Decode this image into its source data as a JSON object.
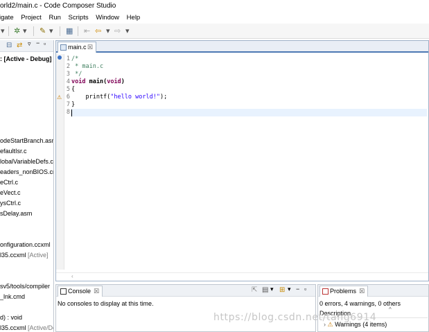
{
  "window": {
    "title": "orld2/main.c - Code Composer Studio"
  },
  "menu": [
    "igate",
    "Project",
    "Run",
    "Scripts",
    "Window",
    "Help"
  ],
  "explorer": {
    "header_label": ": [Active - Debug]",
    "items": [
      {
        "label": "odeStartBranch.asm"
      },
      {
        "label": "efaultIsr.c"
      },
      {
        "label": "lobalVariableDefs.c"
      },
      {
        "label": "eaders_nonBIOS.cm"
      },
      {
        "label": "eCtrl.c"
      },
      {
        "label": "eVect.c"
      },
      {
        "label": "ysCtrl.c"
      },
      {
        "label": "sDelay.asm"
      },
      {
        "label": "onfiguration.ccxml"
      },
      {
        "label": "l35.ccxml",
        "tag": "[Active]"
      },
      {
        "label": "sv5/tools/compiler"
      },
      {
        "label": "_lnk.cmd"
      },
      {
        "label": "d) : void"
      },
      {
        "label": "l35.ccxml",
        "tag": "[Active/De"
      }
    ]
  },
  "editor": {
    "tab_label": "main.c",
    "close_glyph": "☒",
    "lines": {
      "l1": {
        "num": "1",
        "text": "/*"
      },
      "l2": {
        "num": "2",
        "text": " * main.c"
      },
      "l3": {
        "num": "3",
        "text": " */"
      },
      "l4": {
        "num": "4",
        "kw": "void",
        "fn": " main(",
        "kw2": "void",
        "tail": ")"
      },
      "l5": {
        "num": "5",
        "text": "{"
      },
      "l6": {
        "num": "6",
        "indent": "    printf(",
        "str": "\"hello world!\"",
        "tail": ");"
      },
      "l7": {
        "num": "7",
        "text": "}"
      },
      "l8": {
        "num": "8",
        "text": ""
      }
    }
  },
  "console": {
    "tab_label": "Console",
    "close_glyph": "☒",
    "message": "No consoles to display at this time."
  },
  "problems": {
    "tab_label": "Problems",
    "close_glyph": "☒",
    "summary": "0 errors, 4 warnings, 0 others",
    "column": "Description",
    "row_label": "Warnings (4 items)"
  },
  "watermark": "https://blog.csdn.net/tang6914",
  "colors": {
    "accent": "#4d78b3",
    "comment": "#3f7f5f",
    "keyword": "#7f0055",
    "string": "#2a00ff"
  }
}
